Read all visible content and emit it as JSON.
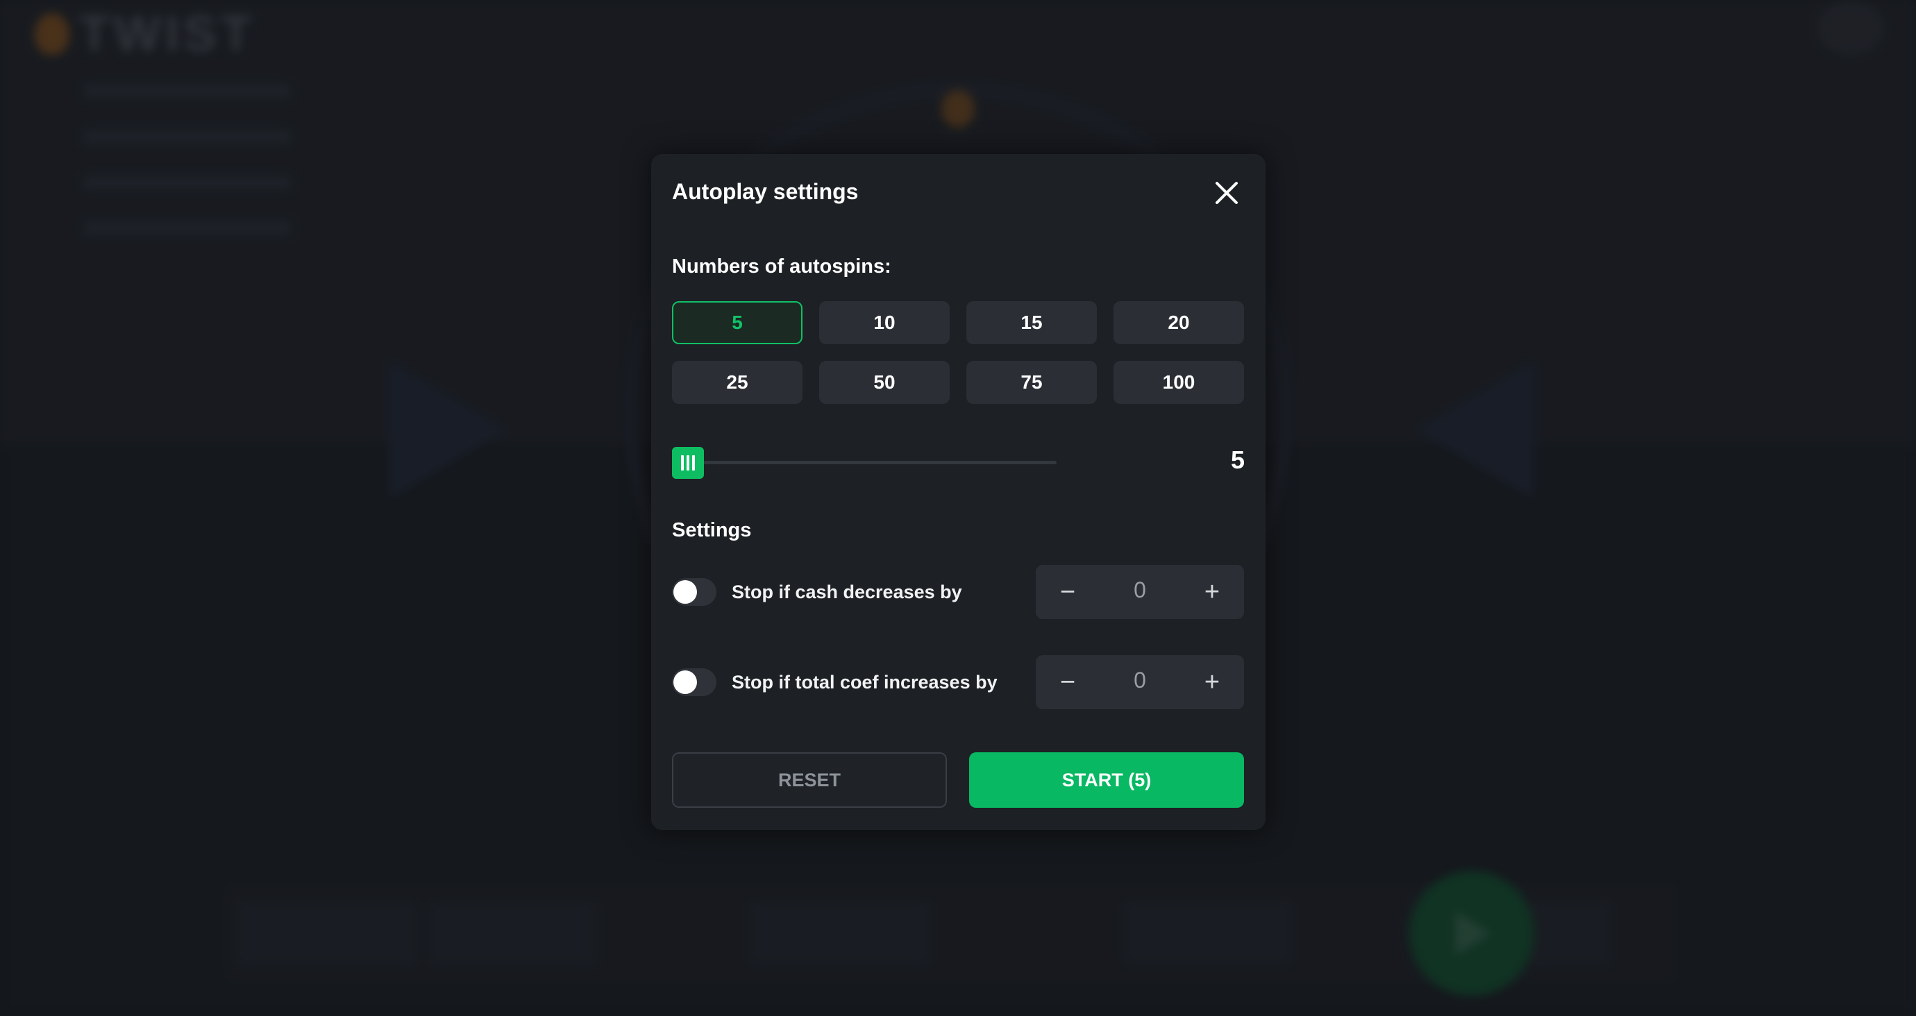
{
  "app": {
    "logo_text": "TWIST"
  },
  "modal": {
    "title": "Autoplay settings",
    "autospins_label": "Numbers of autospins:",
    "autospin_options": [
      "5",
      "10",
      "15",
      "20",
      "25",
      "50",
      "75",
      "100"
    ],
    "selected_option": "5",
    "slider_value": "5",
    "settings_label": "Settings",
    "stop_cash": {
      "label": "Stop if cash decreases by",
      "enabled": false,
      "value": "0",
      "minus": "−",
      "plus": "+"
    },
    "stop_coef": {
      "label": "Stop if total coef increases by",
      "enabled": false,
      "value": "0",
      "minus": "−",
      "plus": "+"
    },
    "reset_label": "RESET",
    "start_label": "START (5)"
  },
  "colors": {
    "accent_green": "#08b863",
    "modal_bg": "#1d2024",
    "button_bg": "#2b2f35"
  },
  "icons": {
    "close": "close-icon",
    "slider_handle": "grip-icon"
  }
}
